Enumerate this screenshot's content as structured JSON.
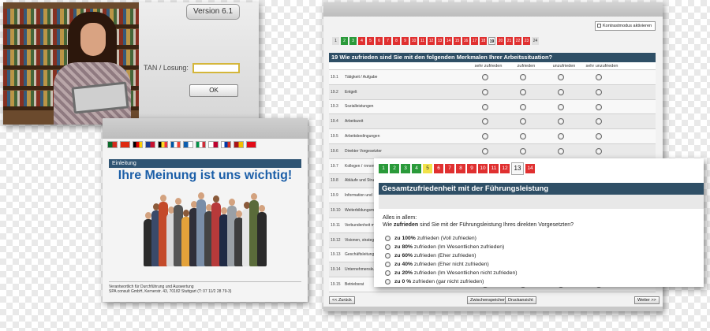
{
  "login": {
    "version": "Version 6.1",
    "tan_label": "TAN / Losung:",
    "tan_value": "",
    "ok_label": "OK"
  },
  "intro": {
    "section_label": "Einleitung",
    "headline": "Ihre Meinung ist uns wichtig!",
    "flags": [
      {
        "name": "portugal-flag",
        "c1": "#0a6a2a",
        "c2": "#d52b1e"
      },
      {
        "name": "china-flag",
        "c1": "#de2910",
        "c2": "#de2910"
      },
      {
        "name": "germany-flag",
        "c1": "#000000",
        "c2": "#dd0000",
        "c3": "#ffce00"
      },
      {
        "name": "uk-flag",
        "c1": "#1d3b8f",
        "c2": "#c8102e"
      },
      {
        "name": "belgium-flag",
        "c1": "#000000",
        "c2": "#fdda24",
        "c3": "#ef3340"
      },
      {
        "name": "france-flag",
        "c1": "#0055a4",
        "c2": "#ffffff",
        "c3": "#ef4135"
      },
      {
        "name": "greece-flag",
        "c1": "#0d5eaf",
        "c2": "#ffffff"
      },
      {
        "name": "italy-flag",
        "c1": "#009246",
        "c2": "#ffffff",
        "c3": "#ce2b37"
      },
      {
        "name": "japan-flag",
        "c1": "#ffffff",
        "c2": "#bc002d"
      },
      {
        "name": "russia-flag",
        "c1": "#ffffff",
        "c2": "#0039a6",
        "c3": "#d52b1e"
      },
      {
        "name": "spain-flag",
        "c1": "#aa151b",
        "c2": "#f1bf00"
      },
      {
        "name": "turkey-flag",
        "c1": "#e30a17",
        "c2": "#e30a17"
      }
    ],
    "footer_line1": "Verantwortlich für Durchführung und Auswertung",
    "footer_line2": "SPA consult GmbH, Kernerstr. 43, 70182 Stuttgart (T: 07 11/2 28 79-3)"
  },
  "survey": {
    "contrast_label": "Kontrastmodus aktivieren",
    "pages": [
      {
        "n": "1",
        "s": "gray"
      },
      {
        "n": "2",
        "s": "green"
      },
      {
        "n": "3",
        "s": "green"
      },
      {
        "n": "4",
        "s": "red"
      },
      {
        "n": "5",
        "s": "red"
      },
      {
        "n": "6",
        "s": "red"
      },
      {
        "n": "7",
        "s": "red"
      },
      {
        "n": "8",
        "s": "red"
      },
      {
        "n": "9",
        "s": "red"
      },
      {
        "n": "10",
        "s": "red"
      },
      {
        "n": "11",
        "s": "red"
      },
      {
        "n": "12",
        "s": "red"
      },
      {
        "n": "13",
        "s": "red"
      },
      {
        "n": "14",
        "s": "red"
      },
      {
        "n": "15",
        "s": "red"
      },
      {
        "n": "16",
        "s": "red"
      },
      {
        "n": "17",
        "s": "red"
      },
      {
        "n": "18",
        "s": "red"
      },
      {
        "n": "19",
        "s": "cur"
      },
      {
        "n": "20",
        "s": "red"
      },
      {
        "n": "21",
        "s": "red"
      },
      {
        "n": "22",
        "s": "red"
      },
      {
        "n": "23",
        "s": "red"
      },
      {
        "n": "24",
        "s": "gray"
      }
    ],
    "question_title": "19  Wie zufrieden sind Sie mit den folgenden Merkmalen Ihrer Arbeitssituation?",
    "columns": [
      "sehr zufrieden",
      "zufrieden",
      "unzufrieden",
      "sehr unzufrieden"
    ],
    "items": [
      {
        "num": "19.1",
        "text": "Tätigkeit / Aufgabe"
      },
      {
        "num": "19.2",
        "text": "Entgelt"
      },
      {
        "num": "19.3",
        "text": "Sozialleistungen"
      },
      {
        "num": "19.4",
        "text": "Arbeitszeit"
      },
      {
        "num": "19.5",
        "text": "Arbeitsbedingungen"
      },
      {
        "num": "19.6",
        "text": "Direkter Vorgesetzter"
      },
      {
        "num": "19.7",
        "text": "Kollegen / -innen"
      },
      {
        "num": "19.8",
        "text": "Abläufe und Stru"
      },
      {
        "num": "19.9",
        "text": "Information und"
      },
      {
        "num": "19.10",
        "text": "Weiterbildungsm"
      },
      {
        "num": "19.11",
        "text": "Verbundenheit m"
      },
      {
        "num": "19.12",
        "text": "Visionen, strateg"
      },
      {
        "num": "19.13",
        "text": "Geschäftsleitung"
      },
      {
        "num": "19.14",
        "text": "Unternehmensku"
      },
      {
        "num": "19.15",
        "text": "Betriebsrat"
      }
    ],
    "back_label": "<< Zurück",
    "save_label": "Zwischenspeichern",
    "print_label": "Druckansicht",
    "next_label": "Weiter >>"
  },
  "leadership": {
    "pages": [
      {
        "n": "1",
        "s": "green"
      },
      {
        "n": "2",
        "s": "green"
      },
      {
        "n": "3",
        "s": "green"
      },
      {
        "n": "4",
        "s": "green"
      },
      {
        "n": "5",
        "s": "yellow"
      },
      {
        "n": "6",
        "s": "red"
      },
      {
        "n": "7",
        "s": "red"
      },
      {
        "n": "8",
        "s": "red"
      },
      {
        "n": "9",
        "s": "red"
      },
      {
        "n": "10",
        "s": "red"
      },
      {
        "n": "11",
        "s": "red"
      },
      {
        "n": "12",
        "s": "red"
      },
      {
        "n": "13",
        "s": "cur"
      },
      {
        "n": "14",
        "s": "red"
      }
    ],
    "title": "Gesamtzufriedenheit mit der Führungsleistung",
    "question_line1": "Alles in allem:",
    "question_pre": "Wie ",
    "question_bold": "zufrieden",
    "question_post": " sind Sie mit der Führungsleistung Ihres direkten Vorgesetzten?",
    "options": [
      {
        "bold": "zu 100%",
        "rest": " zufrieden (Voll zufrieden)"
      },
      {
        "bold": "zu 80%",
        "rest": " zufrieden (Im Wesentlichen zufrieden)"
      },
      {
        "bold": "zu 60%",
        "rest": " zufrieden (Eher zufrieden)"
      },
      {
        "bold": "zu 40%",
        "rest": " zufrieden (Eher nicht zufrieden)"
      },
      {
        "bold": "zu 20%",
        "rest": " zufrieden (Im Wesentlichen nicht zufrieden)"
      },
      {
        "bold": "zu 0 %",
        "rest": " zufrieden (gar nicht zufrieden)"
      }
    ]
  }
}
